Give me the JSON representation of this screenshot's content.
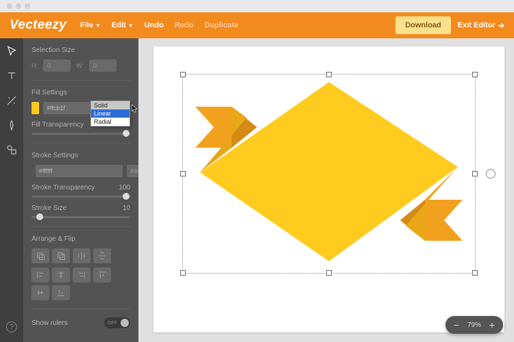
{
  "logo": "Vecteezy",
  "menu": {
    "file": "File",
    "edit": "Edit",
    "undo": "Undo",
    "redo": "Redo",
    "duplicate": "Duplicate"
  },
  "buttons": {
    "download": "Download",
    "exit": "Exit Editor"
  },
  "selection": {
    "label": "Selection Size",
    "h": "H:",
    "w": "W:",
    "hval": "0",
    "wval": "0"
  },
  "fill": {
    "label": "Fill Settings",
    "hex": "#ffcb1f",
    "swatch": "#ffcb1f",
    "transparency_label": "Fill Transparency",
    "options": {
      "solid": "Solid",
      "linear": "Linear",
      "radial": "Radial"
    }
  },
  "stroke": {
    "label": "Stroke Settings",
    "hex": "#ffffff",
    "pos": "Above",
    "transparency_label": "Stroke Transparency",
    "transparency_val": "100",
    "size_label": "Stroke Size",
    "size_val": "10"
  },
  "arrange": {
    "label": "Arrange & Flip"
  },
  "rulers": {
    "label": "Show rulers",
    "state": "OFF"
  },
  "zoom": {
    "value": "79%"
  }
}
